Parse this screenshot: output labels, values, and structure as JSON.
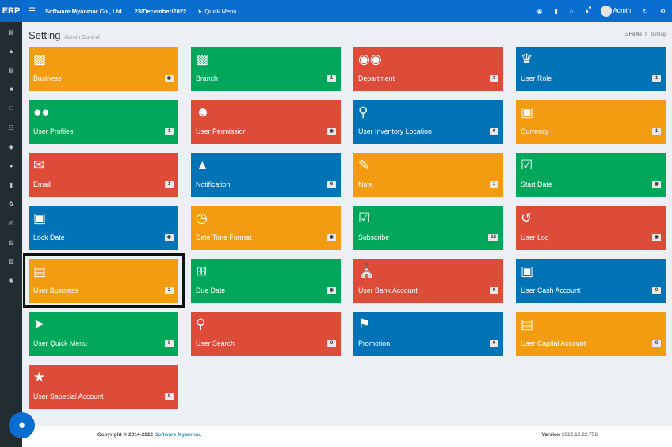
{
  "topbar": {
    "brand": "ERP",
    "menu_icon": "hamburger-icon",
    "company": "Software Myanmar Co., Ltd",
    "date": "23/December/2022",
    "quick_menu": "Quick Menu",
    "user": "Admin"
  },
  "sidebar": {
    "items": [
      "calculator-icon",
      "area-chart-icon",
      "credit-card-icon",
      "cubes-icon",
      "clipboard-icon",
      "cart-icon",
      "diamond-icon",
      "users-icon",
      "bar-chart-icon",
      "leaf-icon",
      "life-ring-icon",
      "book-icon",
      "book-icon",
      "comment-icon"
    ]
  },
  "header": {
    "title": "Setting",
    "subtitle": "Admin Control",
    "breadcrumb_home": "Home",
    "breadcrumb_sep": ">",
    "breadcrumb_current": "Setting"
  },
  "tiles": [
    {
      "label": "Business",
      "badge": "📷",
      "color": "#f39c12",
      "icon": "building-icon"
    },
    {
      "label": "Branch",
      "badge": "1",
      "color": "#00a65a",
      "icon": "building-icon"
    },
    {
      "label": "Department",
      "badge": "3",
      "color": "#dd4b39",
      "icon": "binoculars-icon"
    },
    {
      "label": "User Role",
      "badge": "1",
      "color": "#0073b7",
      "icon": "trophy-icon"
    },
    {
      "label": "User Profiles",
      "badge": "1",
      "color": "#00a65a",
      "icon": "users-icon"
    },
    {
      "label": "User Permission",
      "badge": "📷",
      "color": "#dd4b39",
      "icon": "user-secret-icon"
    },
    {
      "label": "User Inventory Location",
      "badge": "0",
      "color": "#0073b7",
      "icon": "map-marker-icon"
    },
    {
      "label": "Currency",
      "badge": "1",
      "color": "#f39c12",
      "icon": "money-icon"
    },
    {
      "label": "Email",
      "badge": "1",
      "color": "#dd4b39",
      "icon": "envelope-icon"
    },
    {
      "label": "Notification",
      "badge": "6",
      "color": "#0073b7",
      "icon": "bell-icon"
    },
    {
      "label": "Note",
      "badge": "1",
      "color": "#f39c12",
      "icon": "pencil-icon"
    },
    {
      "label": "Start Date",
      "badge": "📷",
      "color": "#00a65a",
      "icon": "calendar-check-icon"
    },
    {
      "label": "Lock Date",
      "badge": "📷",
      "color": "#0073b7",
      "icon": "lock-icon"
    },
    {
      "label": "Date Time Format",
      "badge": "📷",
      "color": "#f39c12",
      "icon": "clock-icon"
    },
    {
      "label": "Subscribe",
      "badge": "12",
      "color": "#00a65a",
      "icon": "check-square-icon"
    },
    {
      "label": "User Log",
      "badge": "📷",
      "color": "#dd4b39",
      "icon": "history-icon"
    },
    {
      "label": "User Business",
      "badge": "2",
      "color": "#f39c12",
      "icon": "archive-icon"
    },
    {
      "label": "Due Date",
      "badge": "📷",
      "color": "#00a65a",
      "icon": "calendar-plus-icon"
    },
    {
      "label": "User Bank Account",
      "badge": "0",
      "color": "#dd4b39",
      "icon": "bank-icon"
    },
    {
      "label": "User Cash Account",
      "badge": "0",
      "color": "#0073b7",
      "icon": "money-icon"
    },
    {
      "label": "User Quick Menu",
      "badge": "0",
      "color": "#00a65a",
      "icon": "rocket-icon"
    },
    {
      "label": "User Search",
      "badge": "0",
      "color": "#dd4b39",
      "icon": "search-icon"
    },
    {
      "label": "Promotion",
      "badge": "0",
      "color": "#0073b7",
      "icon": "tag-icon"
    },
    {
      "label": "User Capital Account",
      "badge": "0",
      "color": "#f39c12",
      "icon": "briefcase-icon"
    },
    {
      "label": "User Sapecial Account",
      "badge": "0",
      "color": "#dd4b39",
      "icon": "star-icon"
    }
  ],
  "footer": {
    "copyright": "Copyright © 2014-2022",
    "link": "Software Myanmar.",
    "version_label": "Version",
    "version": "2022.12.22.756"
  }
}
